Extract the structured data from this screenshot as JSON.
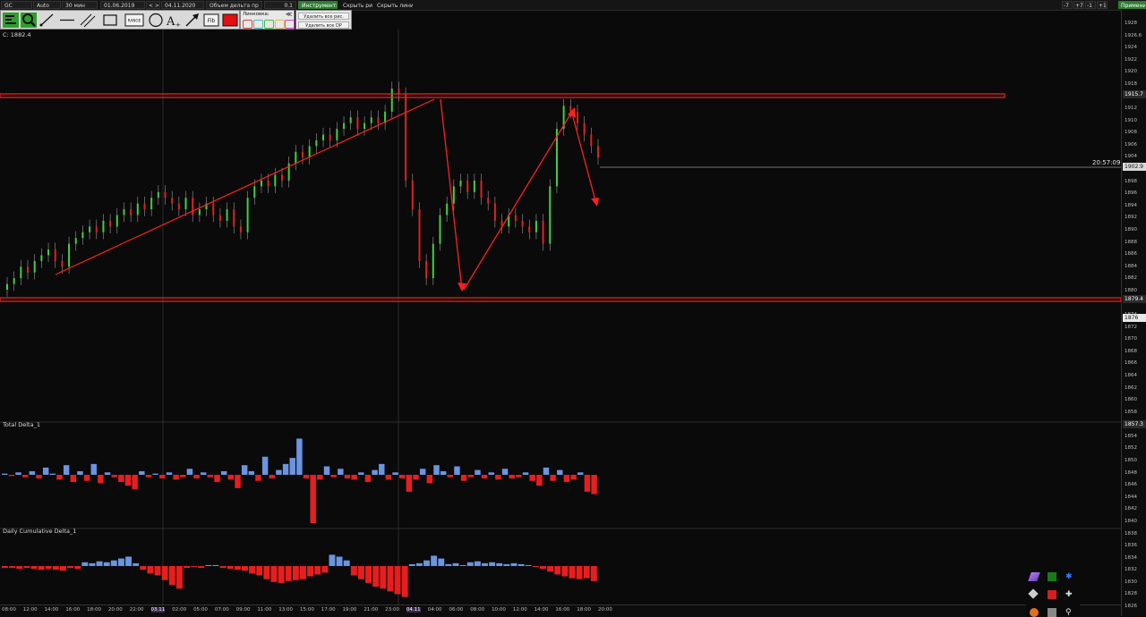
{
  "toolbar": {
    "symbol": "GC",
    "mode": "Auto",
    "timeframe": "30 мин",
    "date_from": "01.06.2019",
    "date_nav": "< >",
    "date_to": "04.11.2020",
    "indicator": "Объем дельта пр",
    "step": "0.1",
    "instruments_btn": "Инструменты",
    "hide_drawings_btn": "Скрыть рис.",
    "hide_lines_btn": "Скрыть линии",
    "zoom_buttons": [
      "-7",
      "+7",
      "-1",
      "+1"
    ],
    "apply_btn": "Примени"
  },
  "tools": {
    "icons": [
      "bars-icon",
      "zoom-icon",
      "ray-icon",
      "hline-icon",
      "channel-icon",
      "rectangle-icon",
      "range-icon",
      "ellipse-icon",
      "text-icon",
      "arrow-icon",
      "fib-icon",
      "fill-color-icon"
    ],
    "range_label": "RANGE",
    "fib_label": "Fib",
    "colors_label": "Линковка:",
    "colors_close": "≪",
    "link_colors": [
      "#e04040",
      "#40c0c0",
      "#40c040",
      "#e0c040",
      "#e040e0"
    ]
  },
  "menu": {
    "delete_all_drawings": "Удалить все рис.",
    "delete_all_dp": "Удалить все DP"
  },
  "chart": {
    "close_label": "C: 1882.4",
    "time_stamp": "20:57:09",
    "price_labels": {
      "top_line": "1915.7",
      "current": "1902.9",
      "bottom_line": "1879.4",
      "cursor": "1876",
      "pane_split": "1857.3"
    },
    "price_ticks": [
      "1928",
      "1926.6",
      "1924",
      "1922",
      "1920",
      "1918",
      "1914",
      "1912",
      "1910",
      "1908",
      "1906",
      "1904",
      "1900",
      "1898",
      "1896",
      "1894",
      "1892",
      "1890",
      "1888",
      "1886",
      "1884",
      "1882",
      "1880",
      "1878",
      "1874",
      "1872",
      "1870",
      "1868",
      "1866",
      "1864",
      "1862",
      "1860",
      "1858",
      "1856",
      "1854",
      "1852",
      "1850",
      "1848",
      "1846",
      "1844",
      "1842",
      "1840",
      "1838",
      "1836",
      "1834",
      "1832",
      "1830",
      "1828",
      "1826"
    ],
    "time_ticks": [
      "08:00",
      "12:00",
      "14:00",
      "16:00",
      "18:00",
      "20:00",
      "22:00",
      "03.11",
      "02:00",
      "05:00",
      "07:00",
      "09:00",
      "11:00",
      "13:00",
      "15:00",
      "17:00",
      "19:00",
      "21:00",
      "23:00",
      "04.11",
      "04:00",
      "06:00",
      "08:00",
      "10:00",
      "12:00",
      "14:00",
      "16:00",
      "18:00",
      "20:00"
    ],
    "pane1_title": "Total Delta_1",
    "pane2_title": "Daily Cumulative Delta_1",
    "level_color": "#ff2020",
    "up_color": "#3fd03f",
    "down_color": "#e02020",
    "delta_pos_color": "#6a95e0",
    "delta_neg_color": "#e81e1e"
  },
  "chart_data": {
    "type": "candlestick",
    "candles_close": [
      1881,
      1882,
      1884,
      1883,
      1885,
      1886,
      1887,
      1885,
      1884,
      1888,
      1889,
      1890,
      1891,
      1890,
      1892,
      1891,
      1893,
      1894,
      1893,
      1895,
      1894,
      1896,
      1897,
      1896,
      1895,
      1894,
      1896,
      1893,
      1894,
      1895,
      1893,
      1892,
      1894,
      1891,
      1890,
      1896,
      1898,
      1899,
      1898,
      1900,
      1899,
      1902,
      1904,
      1903,
      1905,
      1906,
      1907,
      1906,
      1908,
      1909,
      1910,
      1908,
      1909,
      1910,
      1909,
      1911,
      1915,
      1914,
      1899,
      1894,
      1885,
      1882,
      1888,
      1893,
      1895,
      1898,
      1899,
      1897,
      1899,
      1896,
      1895,
      1892,
      1891,
      1893,
      1892,
      1891,
      1890,
      1892,
      1888,
      1898,
      1908,
      1912,
      1911,
      1909,
      1907,
      1905,
      1903
    ],
    "total_delta": [
      1,
      -1,
      2,
      -2,
      3,
      -3,
      6,
      1,
      -4,
      8,
      -6,
      3,
      -5,
      9,
      -7,
      2,
      -2,
      -6,
      -9,
      -12,
      3,
      -2,
      1,
      -3,
      2,
      -4,
      -2,
      5,
      -3,
      2,
      -2,
      -6,
      3,
      -4,
      -11,
      8,
      3,
      -5,
      15,
      -3,
      4,
      9,
      14,
      30,
      -3,
      -40,
      -4,
      7,
      -2,
      5,
      -3,
      -4,
      2,
      -6,
      4,
      9,
      -4,
      2,
      -3,
      -14,
      -4,
      5,
      -7,
      8,
      3,
      -2,
      7,
      -5,
      -2,
      4,
      -3,
      2,
      -4,
      5,
      -3,
      -2,
      2,
      -5,
      -9,
      6,
      -5,
      4,
      -6,
      -4,
      2,
      -14,
      -16
    ],
    "cumulative_delta": [
      -2,
      -2,
      -3,
      -2,
      -3,
      -4,
      -3,
      -4,
      -5,
      -2,
      -3,
      4,
      3,
      5,
      4,
      6,
      8,
      10,
      3,
      -4,
      -8,
      -10,
      -15,
      -20,
      -24,
      -2,
      -1,
      -2,
      1,
      1,
      -2,
      -3,
      -4,
      -5,
      -8,
      -10,
      -14,
      -17,
      -18,
      -16,
      -15,
      -14,
      -11,
      -9,
      -7,
      12,
      10,
      6,
      -10,
      -14,
      -18,
      -22,
      -24,
      -27,
      -30,
      -33,
      2,
      3,
      6,
      11,
      8,
      2,
      3,
      1,
      4,
      5,
      3,
      4,
      3,
      2,
      3,
      2,
      1,
      -1,
      -3,
      -6,
      -9,
      -11,
      -13,
      -14,
      -13,
      -16
    ]
  }
}
